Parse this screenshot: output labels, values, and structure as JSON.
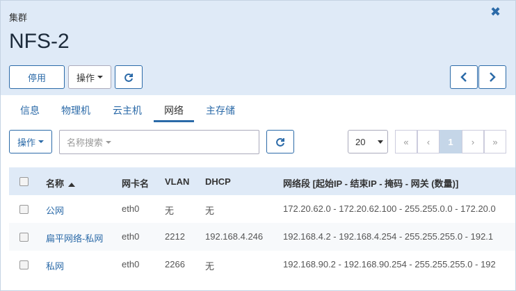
{
  "header": {
    "breadcrumb": "集群",
    "title": "NFS-2",
    "disable_label": "停用",
    "actions_label": "操作"
  },
  "tabs": [
    {
      "label": "信息"
    },
    {
      "label": "物理机"
    },
    {
      "label": "云主机"
    },
    {
      "label": "网络"
    },
    {
      "label": "主存储"
    }
  ],
  "toolbar": {
    "actions_label": "操作",
    "search_placeholder": "名称搜索",
    "page_size": "20",
    "pager": [
      "«",
      "‹",
      "1",
      "›",
      "»"
    ]
  },
  "table": {
    "columns": [
      "名称",
      "网卡名",
      "VLAN",
      "DHCP",
      "网络段 [起始IP - 结束IP - 掩码 - 网关 (数量)]"
    ],
    "rows": [
      {
        "name": "公网",
        "nic": "eth0",
        "vlan": "无",
        "dhcp": "无",
        "range": "172.20.62.0 - 172.20.62.100 - 255.255.0.0 - 172.20.0"
      },
      {
        "name": "扁平网络-私网",
        "nic": "eth0",
        "vlan": "2212",
        "dhcp": "192.168.4.246",
        "range": "192.168.4.2 - 192.168.4.254 - 255.255.255.0 - 192.1"
      },
      {
        "name": "私网",
        "nic": "eth0",
        "vlan": "2266",
        "dhcp": "无",
        "range": "192.168.90.2 - 192.168.90.254 - 255.255.255.0 - 192"
      }
    ]
  }
}
